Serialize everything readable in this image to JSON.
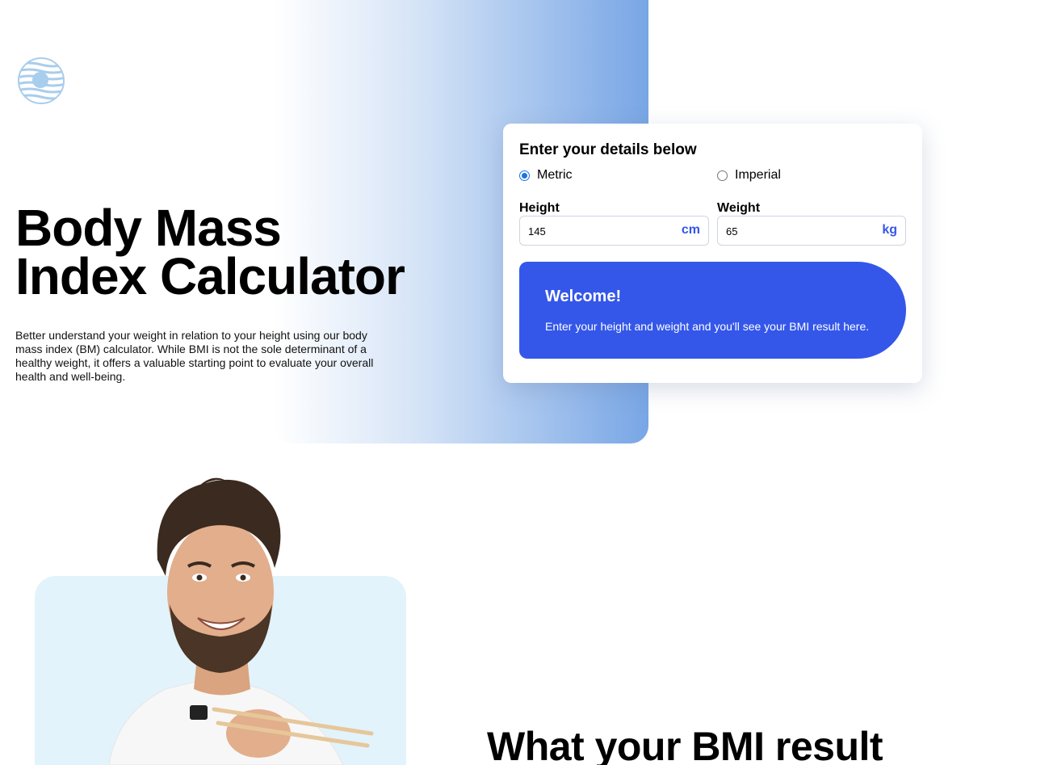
{
  "hero": {
    "title": "Body Mass\nIndex Calculator",
    "description": "Better understand your weight in relation to your height using our body mass index (BM) calculator. While BMI is not the sole determinant of a healthy weight, it offers a valuable starting point to evaluate your overall health and well-being."
  },
  "logo": {
    "icon": "logo-icon"
  },
  "form": {
    "title": "Enter your details below",
    "units": [
      {
        "label": "Metric",
        "selected": true
      },
      {
        "label": "Imperial",
        "selected": false
      }
    ],
    "height": {
      "label": "Height",
      "value": "145",
      "unit": "cm"
    },
    "weight": {
      "label": "Weight",
      "value": "65",
      "unit": "kg"
    }
  },
  "result": {
    "title": "Welcome!",
    "text": "Enter your height and weight and you'll see your BMI result here."
  },
  "section": {
    "title": "What your BMI result"
  },
  "colors": {
    "accent": "#3457ea",
    "unit_text": "#3456e8",
    "photo_bg": "#e3f3fb"
  }
}
